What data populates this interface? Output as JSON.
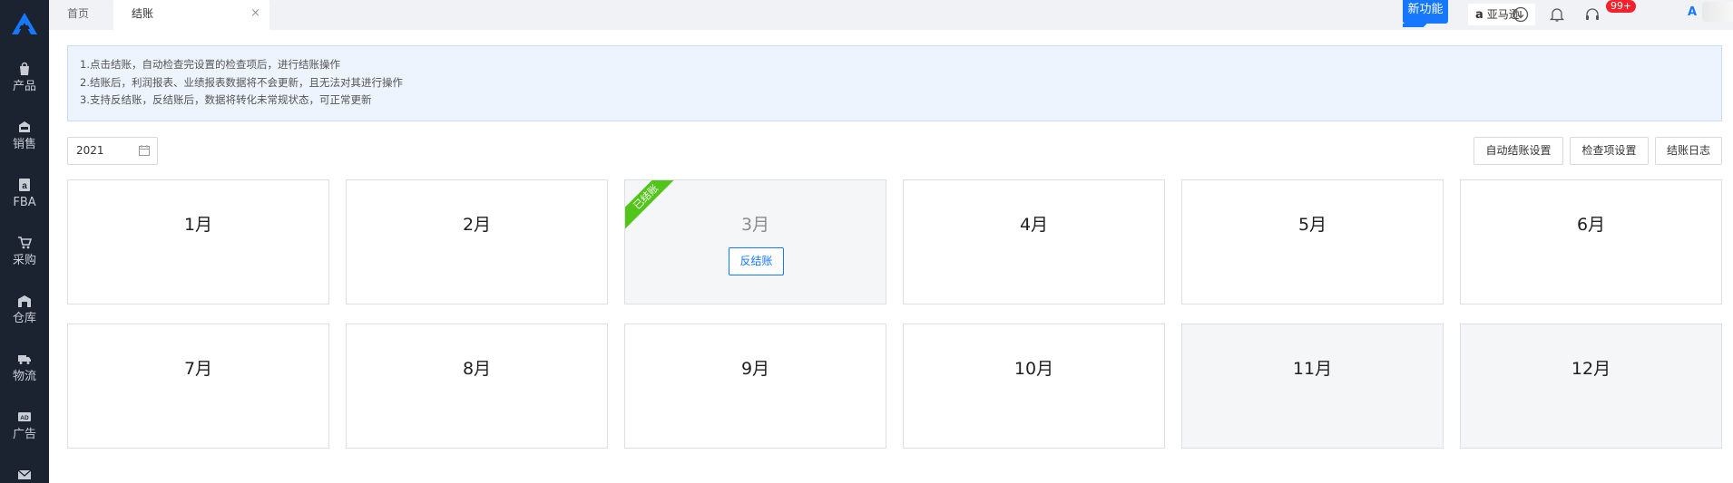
{
  "sidebar": {
    "items": [
      {
        "label": "产品",
        "icon": "bag-icon"
      },
      {
        "label": "销售",
        "icon": "sell-icon"
      },
      {
        "label": "FBA",
        "icon": "amazon-icon"
      },
      {
        "label": "采购",
        "icon": "cart-icon"
      },
      {
        "label": "仓库",
        "icon": "warehouse-icon"
      },
      {
        "label": "物流",
        "icon": "truck-icon"
      },
      {
        "label": "广告",
        "icon": "ad-icon"
      }
    ]
  },
  "tabs": {
    "home": "首页",
    "active": "结账",
    "close_symbol": "×"
  },
  "header": {
    "new_feature": "新功能",
    "store_name": "亚马逊",
    "store_icon": "a",
    "notification_count": "99+",
    "brand_letter": "A"
  },
  "notice": {
    "lines": [
      "1.点击结账，自动检查完设置的检查项后，进行结账操作",
      "2.结账后，利润报表、业绩报表数据将不会更新，且无法对其进行操作",
      "3.支持反结账，反结账后，数据将转化未常规状态，可正常更新"
    ]
  },
  "filters": {
    "year": "2021"
  },
  "actions": {
    "auto_settings": "自动结账设置",
    "check_items": "检查项设置",
    "log": "结账日志"
  },
  "months": [
    {
      "label": "1月"
    },
    {
      "label": "2月"
    },
    {
      "label": "3月",
      "status": "已结账",
      "action": "反结账"
    },
    {
      "label": "4月"
    },
    {
      "label": "5月"
    },
    {
      "label": "6月"
    },
    {
      "label": "7月"
    },
    {
      "label": "8月"
    },
    {
      "label": "9月"
    },
    {
      "label": "10月"
    },
    {
      "label": "11月"
    },
    {
      "label": "12月"
    }
  ],
  "colors": {
    "sidebar_bg": "#1b2230",
    "accent": "#1677ff",
    "closed_ribbon": "#52c41a",
    "badge": "#f5222d"
  }
}
